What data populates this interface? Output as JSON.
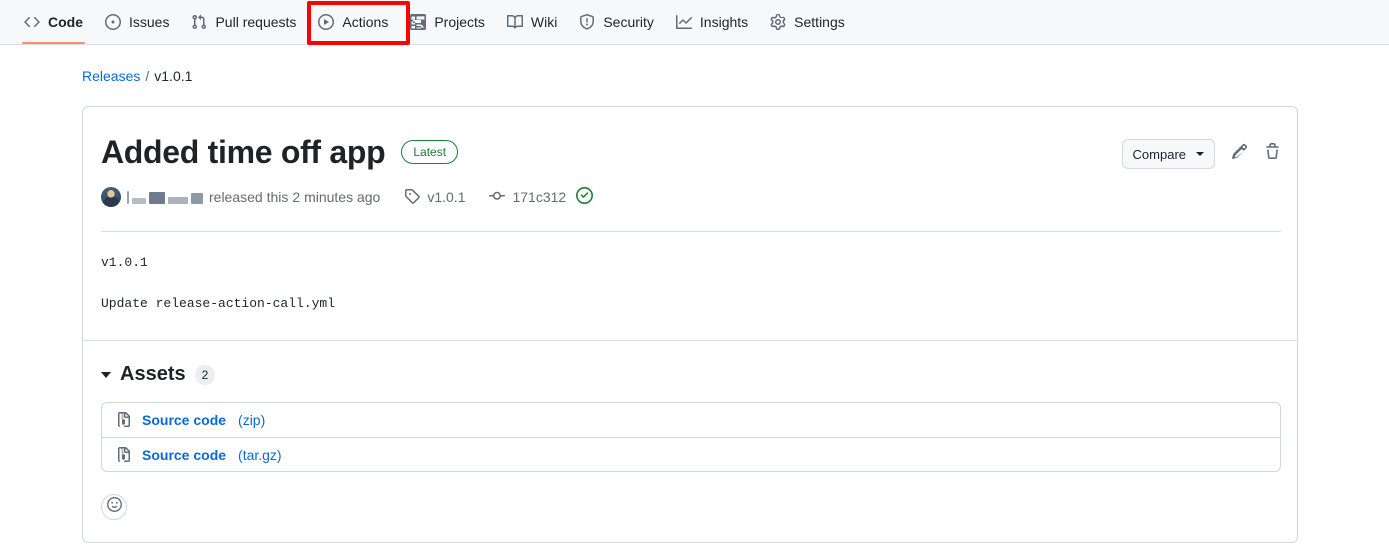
{
  "repo_nav": {
    "items": [
      {
        "label": "Code",
        "icon": "code-icon",
        "selected": true
      },
      {
        "label": "Issues",
        "icon": "issue-opened-icon",
        "selected": false
      },
      {
        "label": "Pull requests",
        "icon": "git-pull-request-icon",
        "selected": false
      },
      {
        "label": "Actions",
        "icon": "play-icon",
        "selected": false
      },
      {
        "label": "Projects",
        "icon": "table-icon",
        "selected": false
      },
      {
        "label": "Wiki",
        "icon": "book-icon",
        "selected": false
      },
      {
        "label": "Security",
        "icon": "shield-icon",
        "selected": false
      },
      {
        "label": "Insights",
        "icon": "graph-icon",
        "selected": false
      },
      {
        "label": "Settings",
        "icon": "gear-icon",
        "selected": false
      }
    ],
    "selected_underline_color": "#fd8c73",
    "annotation": {
      "target": "Actions",
      "color": "#ff0000"
    }
  },
  "breadcrumb": {
    "root_label": "Releases",
    "separator": "/",
    "current_label": "v1.0.1"
  },
  "release": {
    "title": "Added time off app",
    "badge": "Latest",
    "badge_color": "#1a7f37",
    "compare_label": "Compare",
    "edit_icon": "pencil-icon",
    "delete_icon": "trash-icon",
    "author_redacted": true,
    "released_text": "released this",
    "released_time": "2 minutes ago",
    "tag": "v1.0.1",
    "commit": "171c312",
    "verified": true,
    "body_lines": [
      "v1.0.1",
      "Update release-action-call.yml"
    ]
  },
  "assets": {
    "title": "Assets",
    "count": "2",
    "items": [
      {
        "name": "Source code",
        "ext": "(zip)"
      },
      {
        "name": "Source code",
        "ext": "(tar.gz)"
      }
    ]
  },
  "reaction": {
    "icon": "smiley-icon"
  }
}
